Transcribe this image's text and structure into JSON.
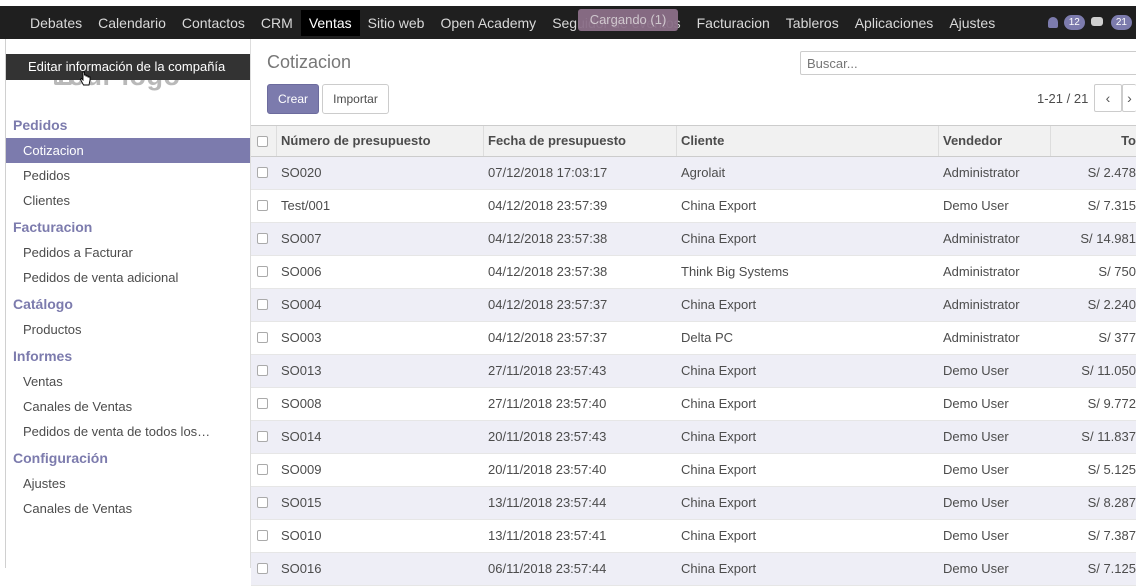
{
  "topbar": {
    "menu": [
      "Debates",
      "Calendario",
      "Contactos",
      "CRM",
      "Ventas",
      "Sitio web",
      "Open Academy",
      "Seguidor de eventos",
      "Facturacion",
      "Tableros",
      "Aplicaciones",
      "Ajustes"
    ],
    "active": "Ventas",
    "loading": "Cargando (1)",
    "badge_messages": "12",
    "badge_activities": "21"
  },
  "sidebar": {
    "logo_text": "Your logo",
    "tooltip": "Editar información de la compañía",
    "sections": [
      {
        "title": "Pedidos",
        "items": [
          "Cotizacion",
          "Pedidos",
          "Clientes"
        ]
      },
      {
        "title": "Facturacion",
        "items": [
          "Pedidos a Facturar",
          "Pedidos de venta adicional"
        ]
      },
      {
        "title": "Catálogo",
        "items": [
          "Productos"
        ]
      },
      {
        "title": "Informes",
        "items": [
          "Ventas",
          "Canales de Ventas",
          "Pedidos de venta de todos los…"
        ]
      },
      {
        "title": "Configuración",
        "items": [
          "Ajustes",
          "Canales de Ventas"
        ]
      }
    ],
    "active_item": "Cotizacion"
  },
  "main": {
    "title": "Cotizacion",
    "search_placeholder": "Buscar...",
    "create_label": "Crear",
    "import_label": "Importar",
    "pager": "1-21 / 21",
    "columns": [
      "Número de presupuesto",
      "Fecha de presupuesto",
      "Cliente",
      "Vendedor",
      "To"
    ],
    "rows": [
      [
        "SO020",
        "07/12/2018 17:03:17",
        "Agrolait",
        "Administrator",
        "S/ 2.478"
      ],
      [
        "Test/001",
        "04/12/2018 23:57:39",
        "China Export",
        "Demo User",
        "S/ 7.315"
      ],
      [
        "SO007",
        "04/12/2018 23:57:38",
        "China Export",
        "Administrator",
        "S/ 14.981"
      ],
      [
        "SO006",
        "04/12/2018 23:57:38",
        "Think Big Systems",
        "Administrator",
        "S/ 750"
      ],
      [
        "SO004",
        "04/12/2018 23:57:37",
        "China Export",
        "Administrator",
        "S/ 2.240"
      ],
      [
        "SO003",
        "04/12/2018 23:57:37",
        "Delta PC",
        "Administrator",
        "S/ 377"
      ],
      [
        "SO013",
        "27/11/2018 23:57:43",
        "China Export",
        "Demo User",
        "S/ 11.050"
      ],
      [
        "SO008",
        "27/11/2018 23:57:40",
        "China Export",
        "Demo User",
        "S/ 9.772"
      ],
      [
        "SO014",
        "20/11/2018 23:57:43",
        "China Export",
        "Demo User",
        "S/ 11.837"
      ],
      [
        "SO009",
        "20/11/2018 23:57:40",
        "China Export",
        "Demo User",
        "S/ 5.125"
      ],
      [
        "SO015",
        "13/11/2018 23:57:44",
        "China Export",
        "Demo User",
        "S/ 8.287"
      ],
      [
        "SO010",
        "13/11/2018 23:57:41",
        "China Export",
        "Demo User",
        "S/ 7.387"
      ],
      [
        "SO016",
        "06/11/2018 23:57:44",
        "China Export",
        "Demo User",
        "S/ 7.125"
      ]
    ]
  }
}
